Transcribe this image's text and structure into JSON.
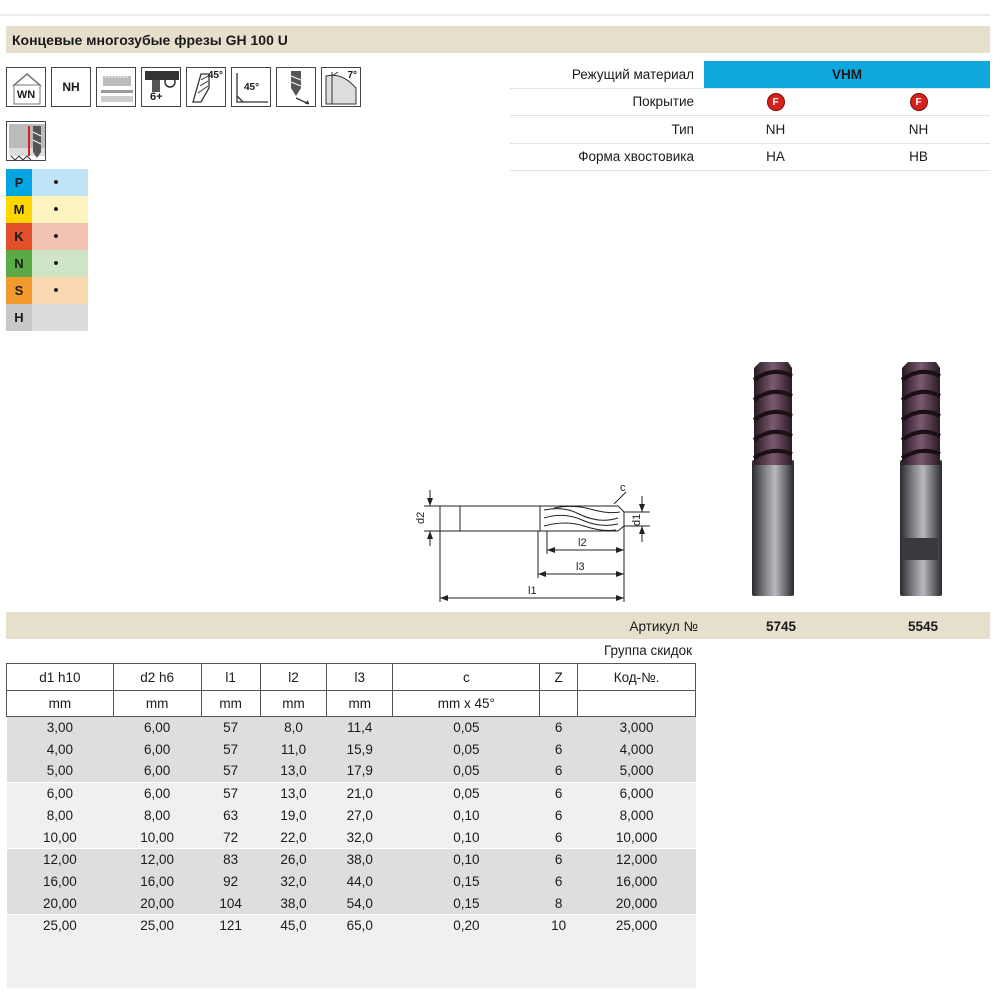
{
  "title": "Концевые многозубые фрезы GH 100 U",
  "icons": [
    {
      "name": "wn-icon",
      "label": "WN"
    },
    {
      "name": "nh-icon",
      "label": "NH"
    },
    {
      "name": "cutting-depth-icon",
      "label": ""
    },
    {
      "name": "flutes-6plus-icon",
      "label": "6+"
    },
    {
      "name": "helix-45-icon",
      "label": "45°"
    },
    {
      "name": "chamfer-45-icon",
      "label": "45°"
    },
    {
      "name": "plunge-icon",
      "label": ""
    },
    {
      "name": "angle-7-icon",
      "label": "7°"
    }
  ],
  "materials": [
    {
      "letter": "P",
      "color": "#00a5e3",
      "bg": "#bfe4f5",
      "dot": "•"
    },
    {
      "letter": "M",
      "color": "#ffd700",
      "bg": "#fdf3bf",
      "dot": "•"
    },
    {
      "letter": "K",
      "color": "#e2502b",
      "bg": "#f2c3b3",
      "dot": "•"
    },
    {
      "letter": "N",
      "color": "#5aaa46",
      "bg": "#cfe5c6",
      "dot": "•"
    },
    {
      "letter": "S",
      "color": "#f39a2e",
      "bg": "#fad9b2",
      "dot": "•"
    },
    {
      "letter": "H",
      "color": "#c8c8c8",
      "bg": "#dcdcdc",
      "dot": ""
    }
  ],
  "spec": {
    "rows": [
      {
        "label": "Режущий материал",
        "value": "VHM"
      },
      {
        "label": "Покрытие",
        "v1": "F",
        "v2": "F"
      },
      {
        "label": "Тип",
        "v1": "NH",
        "v2": "NH"
      },
      {
        "label": "Форма хвостовика",
        "v1": "HA",
        "v2": "HB"
      }
    ]
  },
  "drawing_labels": {
    "d2": "d2",
    "d1": "d1",
    "c": "c",
    "l1": "l1",
    "l2": "l2",
    "l3": "l3"
  },
  "article": {
    "label": "Артикул №",
    "v1": "5745",
    "v2": "5545"
  },
  "discount_label": "Группа скидок",
  "table": {
    "headers": [
      "d1 h10",
      "d2 h6",
      "l1",
      "l2",
      "l3",
      "c",
      "Z",
      "Код-№."
    ],
    "units": [
      "mm",
      "mm",
      "mm",
      "mm",
      "mm",
      "mm x 45°",
      "",
      ""
    ],
    "groups": [
      [
        [
          "3,00",
          "6,00",
          "57",
          "8,0",
          "11,4",
          "0,05",
          "6",
          "3,000"
        ],
        [
          "4,00",
          "6,00",
          "57",
          "11,0",
          "15,9",
          "0,05",
          "6",
          "4,000"
        ],
        [
          "5,00",
          "6,00",
          "57",
          "13,0",
          "17,9",
          "0,05",
          "6",
          "5,000"
        ]
      ],
      [
        [
          "6,00",
          "6,00",
          "57",
          "13,0",
          "21,0",
          "0,05",
          "6",
          "6,000"
        ],
        [
          "8,00",
          "8,00",
          "63",
          "19,0",
          "27,0",
          "0,10",
          "6",
          "8,000"
        ],
        [
          "10,00",
          "10,00",
          "72",
          "22,0",
          "32,0",
          "0,10",
          "6",
          "10,000"
        ]
      ],
      [
        [
          "12,00",
          "12,00",
          "83",
          "26,0",
          "38,0",
          "0,10",
          "6",
          "12,000"
        ],
        [
          "16,00",
          "16,00",
          "92",
          "32,0",
          "44,0",
          "0,15",
          "6",
          "16,000"
        ],
        [
          "20,00",
          "20,00",
          "104",
          "38,0",
          "54,0",
          "0,15",
          "8",
          "20,000"
        ]
      ],
      [
        [
          "25,00",
          "25,00",
          "121",
          "45,0",
          "65,0",
          "0,20",
          "10",
          "25,000"
        ]
      ]
    ]
  }
}
